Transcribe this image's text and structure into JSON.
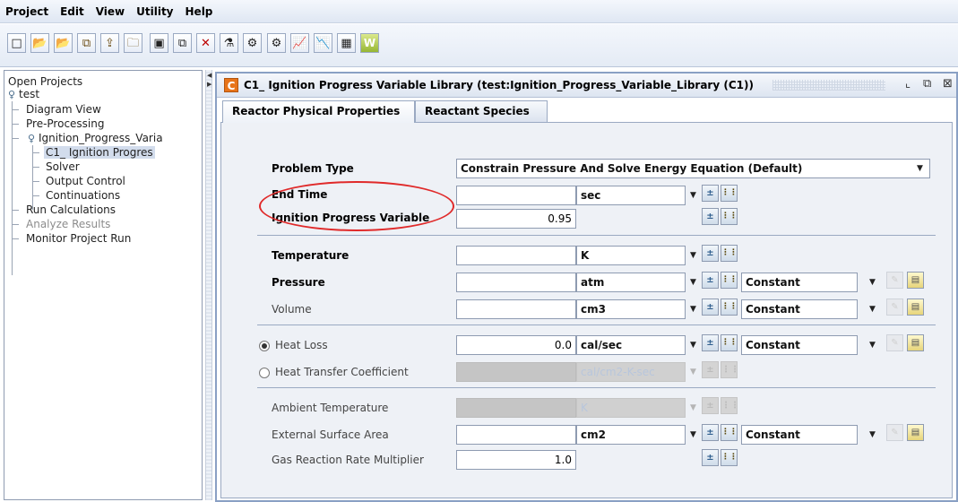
{
  "menu": [
    "Project",
    "Edit",
    "View",
    "Utility",
    "Help"
  ],
  "toolbar": {
    "buttons": [
      {
        "icon": "new-file-icon",
        "glyph": "□"
      },
      {
        "icon": "open-project-icon",
        "glyph": "📂"
      },
      {
        "icon": "open-folder-icon",
        "glyph": "📂"
      },
      {
        "icon": "copy-icon",
        "glyph": "⧉"
      },
      {
        "icon": "import-icon",
        "glyph": "⇪"
      },
      {
        "icon": "folder-icon",
        "glyph": "🗀"
      },
      {
        "icon": "save-icon",
        "glyph": "▣"
      },
      {
        "icon": "save-all-icon",
        "glyph": "⧉"
      },
      {
        "icon": "delete-icon",
        "glyph": "✕"
      },
      {
        "icon": "run-icon",
        "glyph": "⚗"
      },
      {
        "icon": "config-icon",
        "glyph": "⚙"
      },
      {
        "icon": "parameters-icon",
        "glyph": "⚙"
      },
      {
        "icon": "plot-icon",
        "glyph": "📈"
      },
      {
        "icon": "graph-icon",
        "glyph": "📉"
      },
      {
        "icon": "chart-icon",
        "glyph": "▦"
      },
      {
        "icon": "word-icon",
        "glyph": "W"
      }
    ]
  },
  "tree": {
    "root_label": "Open Projects",
    "project": "test",
    "items": {
      "diagram_view": "Diagram View",
      "pre_processing": "Pre-Processing",
      "ignition_folder": "Ignition_Progress_Varia",
      "c1": "C1_ Ignition Progres",
      "solver": "Solver",
      "output_control": "Output Control",
      "continuations": "Continuations",
      "run_calculations": "Run Calculations",
      "analyze_results": "Analyze Results",
      "monitor_project_run": "Monitor Project Run"
    }
  },
  "window": {
    "icon_letter": "C",
    "title": "C1_ Ignition Progress Variable Library (test:Ignition_Progress_Variable_Library (C1))"
  },
  "tabs": [
    "Reactor Physical Properties",
    "Reactant Species"
  ],
  "form": {
    "problem_type": {
      "label": "Problem Type",
      "value": "Constrain Pressure And Solve Energy Equation (Default)"
    },
    "end_time": {
      "label": "End Time",
      "value": "",
      "unit": "sec"
    },
    "ignition_progress_variable": {
      "label": "Ignition Progress Variable",
      "value": "0.95"
    },
    "temperature": {
      "label": "Temperature",
      "value": "",
      "unit": "K"
    },
    "pressure": {
      "label": "Pressure",
      "value": "",
      "unit": "atm",
      "profile": "Constant"
    },
    "volume": {
      "label": "Volume",
      "value": "",
      "unit": "cm3",
      "profile": "Constant"
    },
    "heat_loss": {
      "label": "Heat Loss",
      "value": "0.0",
      "unit": "cal/sec",
      "profile": "Constant",
      "selected": true
    },
    "heat_transfer_coefficient": {
      "label": "Heat Transfer Coefficient",
      "value": "",
      "unit": "cal/cm2-K-sec",
      "selected": false
    },
    "ambient_temperature": {
      "label": "Ambient Temperature",
      "value": "",
      "unit": "K"
    },
    "external_surface_area": {
      "label": "External Surface Area",
      "value": "",
      "unit": "cm2",
      "profile": "Constant"
    },
    "gas_reaction_rate_multiplier": {
      "label": "Gas Reaction Rate Multiplier",
      "value": "1.0"
    }
  },
  "colors": {
    "highlight": "#e02a2a",
    "window_border": "#8aa0c4",
    "title_icon": "#e8741a"
  }
}
